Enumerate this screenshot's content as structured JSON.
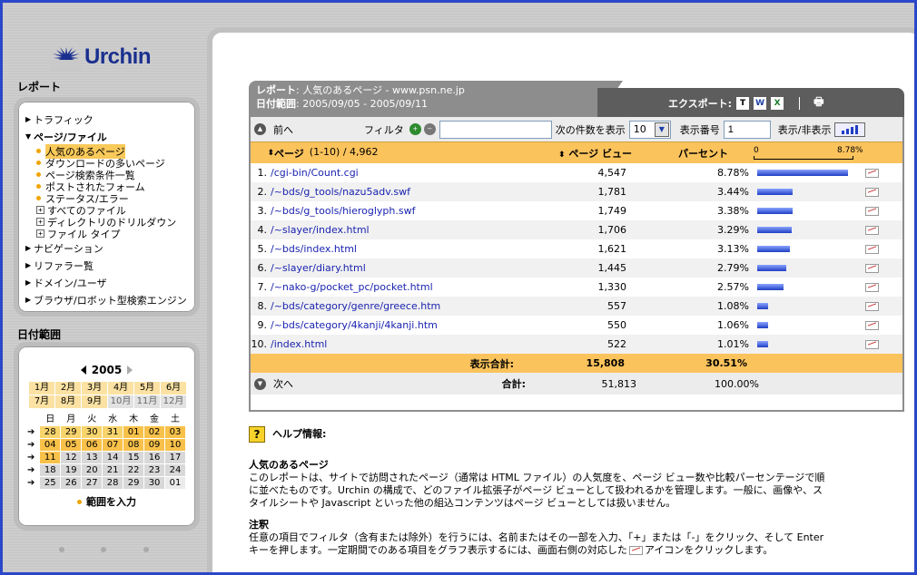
{
  "brand": {
    "logo_text": "Urchin",
    "accent": "#1a2f8f"
  },
  "left": {
    "report_heading": "レポート",
    "nav": [
      {
        "label": "トラフィック",
        "expanded": false
      },
      {
        "label": "ページ/ファイル",
        "expanded": true,
        "bold": true,
        "children": [
          {
            "label": "人気のあるページ",
            "type": "dot",
            "selected": true
          },
          {
            "label": "ダウンロードの多いページ",
            "type": "dot"
          },
          {
            "label": "ページ検索条件一覧",
            "type": "dot"
          },
          {
            "label": "ポストされたフォーム",
            "type": "dot"
          },
          {
            "label": "ステータス/エラー",
            "type": "dot"
          },
          {
            "label": "すべてのファイル",
            "type": "plus"
          },
          {
            "label": "ディレクトリのドリルダウン",
            "type": "plus"
          },
          {
            "label": "ファイル タイプ",
            "type": "plus"
          }
        ]
      },
      {
        "label": "ナビゲーション",
        "expanded": false
      },
      {
        "label": "リファラー覧",
        "expanded": false
      },
      {
        "label": "ドメイン/ユーザ",
        "expanded": false
      },
      {
        "label": "ブラウザ/ロボット型検索エンジン",
        "expanded": false
      }
    ],
    "date_heading": "日付範囲",
    "calendar": {
      "year": "2005",
      "months": [
        {
          "label": "1月",
          "enabled": true
        },
        {
          "label": "2月",
          "enabled": true
        },
        {
          "label": "3月",
          "enabled": true
        },
        {
          "label": "4月",
          "enabled": true
        },
        {
          "label": "5月",
          "enabled": true
        },
        {
          "label": "6月",
          "enabled": true
        },
        {
          "label": "7月",
          "enabled": true
        },
        {
          "label": "8月",
          "enabled": true
        },
        {
          "label": "9月",
          "enabled": true
        },
        {
          "label": "10月",
          "enabled": false
        },
        {
          "label": "11月",
          "enabled": false
        },
        {
          "label": "12月",
          "enabled": false
        }
      ],
      "weekdays": [
        "日",
        "月",
        "火",
        "水",
        "木",
        "金",
        "土"
      ],
      "weeks": [
        {
          "days": [
            "28",
            "29",
            "30",
            "31",
            "01",
            "02",
            "03"
          ],
          "style": [
            "y",
            "y",
            "y",
            "y",
            "o",
            "o",
            "o"
          ]
        },
        {
          "days": [
            "04",
            "05",
            "06",
            "07",
            "08",
            "09",
            "10"
          ],
          "style": [
            "o",
            "o",
            "o",
            "o",
            "o",
            "o",
            "o"
          ]
        },
        {
          "days": [
            "11",
            "12",
            "13",
            "14",
            "15",
            "16",
            "17"
          ],
          "style": [
            "o",
            "g",
            "g",
            "g",
            "g",
            "g",
            "g"
          ]
        },
        {
          "days": [
            "18",
            "19",
            "20",
            "21",
            "22",
            "23",
            "24"
          ],
          "style": [
            "g",
            "g",
            "g",
            "g",
            "g",
            "g",
            "g"
          ]
        },
        {
          "days": [
            "25",
            "26",
            "27",
            "28",
            "29",
            "30",
            "01"
          ],
          "style": [
            "g",
            "g",
            "g",
            "g",
            "g",
            "g",
            "lg"
          ]
        }
      ],
      "range_button": "範囲を入力"
    }
  },
  "report": {
    "title_label": "レポート",
    "title_value": "人気のあるページ - www.psn.ne.jp",
    "date_label": "日付範囲",
    "date_value": "2005/09/05 - 2005/09/11",
    "export_label": "エクスポート:",
    "export_icons": [
      "T",
      "W",
      "X"
    ],
    "prev_label": "前へ",
    "next_label": "次へ",
    "filter_label": "フィルタ",
    "filter_value": "",
    "show_next_label": "次の件数を表示",
    "show_next_value": "10",
    "index_label": "表示番号",
    "index_value": "1",
    "toggle_label": "表示/非表示",
    "col_page": "ページ",
    "col_page_range": "(1-10) / 4,962",
    "col_views": "ページ ビュー",
    "col_percent": "パーセント",
    "scale_min": "0",
    "scale_max": "8.78%",
    "rows": [
      {
        "n": "1.",
        "page": "/cgi-bin/Count.cgi",
        "views": "4,547",
        "pct": "8.78%",
        "frac": 1.0
      },
      {
        "n": "2.",
        "page": "/~bds/g_tools/nazu5adv.swf",
        "views": "1,781",
        "pct": "3.44%",
        "frac": 0.392
      },
      {
        "n": "3.",
        "page": "/~bds/g_tools/hieroglyph.swf",
        "views": "1,749",
        "pct": "3.38%",
        "frac": 0.385
      },
      {
        "n": "4.",
        "page": "/~slayer/index.html",
        "views": "1,706",
        "pct": "3.29%",
        "frac": 0.375
      },
      {
        "n": "5.",
        "page": "/~bds/index.html",
        "views": "1,621",
        "pct": "3.13%",
        "frac": 0.356
      },
      {
        "n": "6.",
        "page": "/~slayer/diary.html",
        "views": "1,445",
        "pct": "2.79%",
        "frac": 0.318
      },
      {
        "n": "7.",
        "page": "/~nako-g/pocket_pc/pocket.html",
        "views": "1,330",
        "pct": "2.57%",
        "frac": 0.293
      },
      {
        "n": "8.",
        "page": "/~bds/category/genre/greece.htm",
        "views": "557",
        "pct": "1.08%",
        "frac": 0.123
      },
      {
        "n": "9.",
        "page": "/~bds/category/4kanji/4kanji.htm",
        "views": "550",
        "pct": "1.06%",
        "frac": 0.121
      },
      {
        "n": "10.",
        "page": "/index.html",
        "views": "522",
        "pct": "1.01%",
        "frac": 0.115
      }
    ],
    "subtotal_label": "表示合計:",
    "subtotal_views": "15,808",
    "subtotal_pct": "30.51%",
    "total_label": "合計:",
    "total_views": "51,813",
    "total_pct": "100.00%"
  },
  "help": {
    "heading": "ヘルプ情報:",
    "sec1_title": "人気のあるページ",
    "sec1_body": "このレポートは、サイトで訪問されたページ（通常は HTML ファイル）の人気度を、ページ ビュー数や比較パーセンテージで順に並べたものです。Urchin の構成で、どのファイル拡張子がページ ビューとして扱われるかを管理します。一般に、画像や、スタイルシートや Javascript といった他の組込コンテンツはページ ビューとしては扱いません。",
    "sec2_title": "注釈",
    "sec2_body_a": "任意の項目でフィルタ（含有または除外）を行うには、名前またはその一部を入力、「+」または「-」をクリック、そして Enter キーを押します。一定期間でのある項目をグラフ表示するには、画面右側の対応した",
    "sec2_body_b": "アイコンをクリックします。"
  }
}
